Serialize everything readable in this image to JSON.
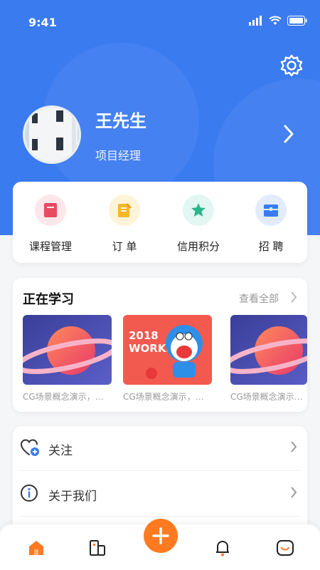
{
  "status_bar": {
    "time": "9:41"
  },
  "profile": {
    "name": "王先生",
    "role": "项目经理"
  },
  "quick_actions": [
    {
      "label": "课程管理",
      "icon": "book-icon",
      "bg": "#fde7ea",
      "color": "#e84a62"
    },
    {
      "label": "订 单",
      "icon": "order-icon",
      "bg": "#fff3d8",
      "color": "#f5b82a"
    },
    {
      "label": "信用积分",
      "icon": "star-icon",
      "bg": "#e3f7f2",
      "color": "#2bb58c"
    },
    {
      "label": "招 聘",
      "icon": "briefcase-icon",
      "bg": "#e2ecfd",
      "color": "#3b7bf0"
    }
  ],
  "learning": {
    "title": "正在学习",
    "view_all": "查看全部",
    "courses": [
      {
        "title": "CG场景概念演示，快…"
      },
      {
        "title": "CG场景概念演示，快…",
        "thumb_text": "2018 WORKS"
      },
      {
        "title": "CG场景概念演示…"
      }
    ]
  },
  "menu": [
    {
      "label": "关注",
      "icon": "heart-plus-icon"
    },
    {
      "label": "关于我们",
      "icon": "info-icon"
    }
  ],
  "tabbar": {
    "items": [
      "home-icon",
      "building-icon",
      "plus-icon",
      "bell-icon",
      "face-icon"
    ],
    "accent": "#ff7a20"
  },
  "colors": {
    "primary": "#3b7bf0"
  }
}
